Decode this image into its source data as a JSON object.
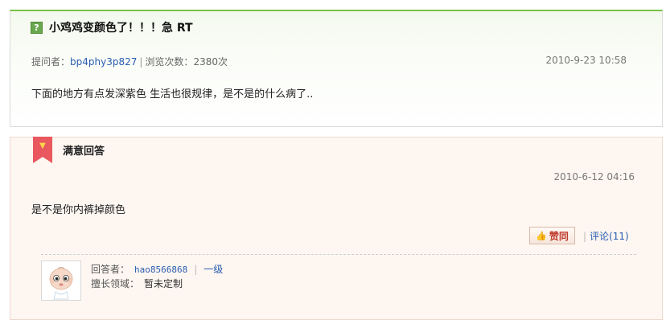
{
  "question": {
    "badge": "?",
    "title": "小鸡鸡变颜色了！！！急 RT",
    "asker_label": "提问者：",
    "asker_name": "bp4phy3p827",
    "separator": "|",
    "views_label": "浏览次数：",
    "views": "2380次",
    "date": "2010-9-23 10:58",
    "body": "下面的地方有点发深紫色 生活也很规律，是不是的什么病了.."
  },
  "answer": {
    "title": "满意回答",
    "date": "2010-6-12 04:16",
    "body": "是不是你内裤掉颜色",
    "like_label": "赞同",
    "comment_label": "评论",
    "comment_count": "(11)",
    "comment_separator": "|",
    "responder_label": "回答者：",
    "responder_name": "hao8566868",
    "responder_sep": "|",
    "responder_level": "一级",
    "expertise_label": "擅长领域：",
    "expertise_value": "暂未定制"
  },
  "colors": {
    "accent_green": "#7ac143",
    "ribbon_red": "#e8585e",
    "link_blue": "#2a5db0"
  }
}
